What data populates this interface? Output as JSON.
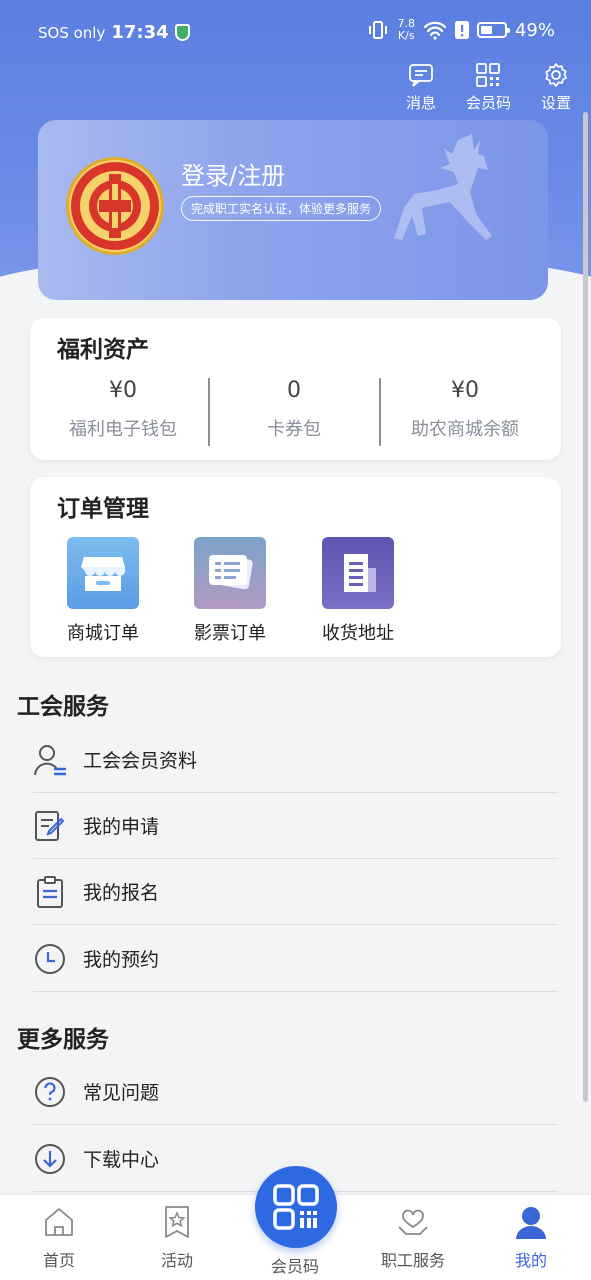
{
  "status_bar": {
    "carrier": "SOS only",
    "time": "17:34",
    "speed_top": "7.8",
    "speed_bottom": "K/s",
    "battery_percent": 49,
    "battery_text": "49%"
  },
  "top_actions": [
    {
      "label": "消息",
      "icon": "message-icon"
    },
    {
      "label": "会员码",
      "icon": "qrcode-icon"
    },
    {
      "label": "设置",
      "icon": "gear-icon"
    }
  ],
  "profile": {
    "login_label": "登录/注册",
    "subtitle": "完成职工实名认证，体验更多服务"
  },
  "assets": {
    "title": "福利资产",
    "items": [
      {
        "value": "¥0",
        "label": "福利电子钱包"
      },
      {
        "value": "0",
        "label": "卡券包"
      },
      {
        "value": "¥0",
        "label": "助农商城余额"
      }
    ]
  },
  "orders": {
    "title": "订单管理",
    "items": [
      {
        "label": "商城订单",
        "icon": "store-icon",
        "color": "#6aaee9"
      },
      {
        "label": "影票订单",
        "icon": "ticket-icon",
        "color": "#9a8fc1"
      },
      {
        "label": "收货地址",
        "icon": "building-icon",
        "color": "#6a5fb6"
      }
    ]
  },
  "union_services": {
    "title": "工会服务",
    "items": [
      {
        "label": "工会会员资料",
        "icon": "member-profile-icon"
      },
      {
        "label": "我的申请",
        "icon": "edit-document-icon"
      },
      {
        "label": "我的报名",
        "icon": "clipboard-icon"
      },
      {
        "label": "我的预约",
        "icon": "clock-icon"
      }
    ]
  },
  "more_services": {
    "title": "更多服务",
    "items": [
      {
        "label": "常见问题",
        "icon": "question-icon"
      },
      {
        "label": "下载中心",
        "icon": "download-icon"
      }
    ]
  },
  "bottom_nav": {
    "items": [
      {
        "label": "首页",
        "icon": "home-icon",
        "active": false
      },
      {
        "label": "活动",
        "icon": "bookmark-star-icon",
        "active": false
      },
      {
        "label": "会员码",
        "icon": "qrcode-icon",
        "active": false
      },
      {
        "label": "职工服务",
        "icon": "heart-hands-icon",
        "active": false
      },
      {
        "label": "我的",
        "icon": "user-icon",
        "active": true
      }
    ]
  },
  "colors": {
    "accent": "#2f68e3",
    "active_tab": "#3a66d8"
  }
}
